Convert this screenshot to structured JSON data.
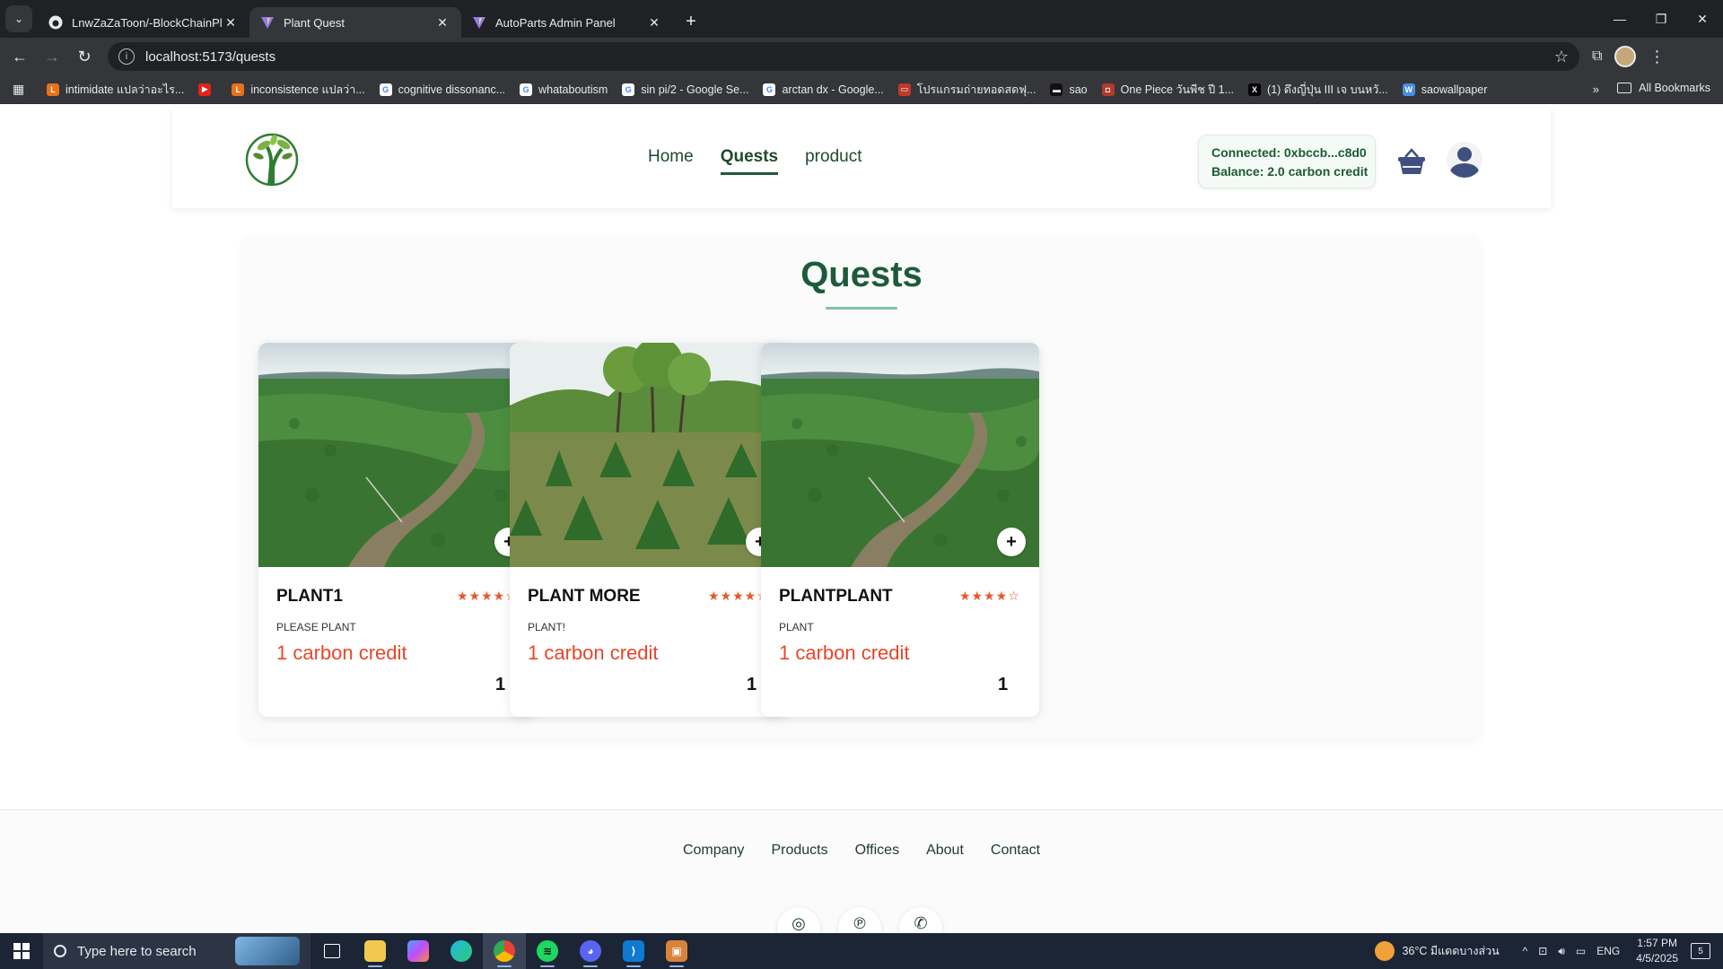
{
  "browser": {
    "tabs": [
      {
        "title": "LnwZaZaToon/-BlockChainPlant",
        "icon": "github-icon",
        "active": false
      },
      {
        "title": "Plant Quest",
        "icon": "vite-icon",
        "active": true
      },
      {
        "title": "AutoParts Admin Panel",
        "icon": "vite-icon",
        "active": false
      }
    ],
    "url": "localhost:5173/quests",
    "bookmarks": [
      {
        "label": "intimidate แปลว่าอะไร...",
        "color": "#e8711a",
        "glyph": "L"
      },
      {
        "label": "",
        "color": "#e62117",
        "glyph": "▶"
      },
      {
        "label": "inconsistence แปลว่า...",
        "color": "#e8711a",
        "glyph": "L"
      },
      {
        "label": "cognitive dissonanc...",
        "color": "#ffffff",
        "glyph": "G"
      },
      {
        "label": "whataboutism",
        "color": "#ffffff",
        "glyph": "G"
      },
      {
        "label": "sin pi/2 - Google Se...",
        "color": "#ffffff",
        "glyph": "G"
      },
      {
        "label": "arctan dx - Google...",
        "color": "#ffffff",
        "glyph": "G"
      },
      {
        "label": "โปรแกรมถ่ายทอดสดฟุ...",
        "color": "#c0392b",
        "glyph": "▭"
      },
      {
        "label": "sao",
        "color": "#111111",
        "glyph": "▬"
      },
      {
        "label": "One Piece วันพีช ปี 1...",
        "color": "#b03a2e",
        "glyph": "◘"
      },
      {
        "label": "(1) ดึงญี่ปุ่น III เจ บนหวั...",
        "color": "#000000",
        "glyph": "X"
      },
      {
        "label": "saowallpaper",
        "color": "#4a8ee0",
        "glyph": "W"
      }
    ],
    "all_bookmarks": "All Bookmarks"
  },
  "site": {
    "nav": [
      {
        "label": "Home",
        "active": false
      },
      {
        "label": "Quests",
        "active": true
      },
      {
        "label": "product",
        "active": false
      }
    ],
    "wallet": {
      "connected": "Connected: 0xbccb...c8d0",
      "balance": "Balance: 2.0 carbon credit"
    }
  },
  "quests": {
    "title": "Quests",
    "items": [
      {
        "name": "PLANT1",
        "description": "PLEASE PLANT",
        "price": "1 carbon credit",
        "quantity": "1",
        "rating": 4,
        "image": "river-forest"
      },
      {
        "name": "PLANT MORE",
        "description": "PLANT!",
        "price": "1 carbon credit",
        "quantity": "1",
        "rating": 4,
        "image": "sapling-field"
      },
      {
        "name": "PLANTPLANT",
        "description": "PLANT",
        "price": "1 carbon credit",
        "quantity": "1",
        "rating": 4,
        "image": "river-forest"
      }
    ]
  },
  "footer": {
    "links": [
      "Company",
      "Products",
      "Offices",
      "About",
      "Contact"
    ],
    "socials": [
      "instagram-icon",
      "pinterest-icon",
      "whatsapp-icon"
    ]
  },
  "taskbar": {
    "search_placeholder": "Type here to search",
    "weather": "36°C  มีแดดบางส่วน",
    "lang": "ENG",
    "time": "1:57 PM",
    "date": "4/5/2025",
    "notification_count": "5"
  },
  "colors": {
    "brand_green": "#1d5a3a",
    "price_red": "#e8462a",
    "star_orange": "#e8562a"
  }
}
